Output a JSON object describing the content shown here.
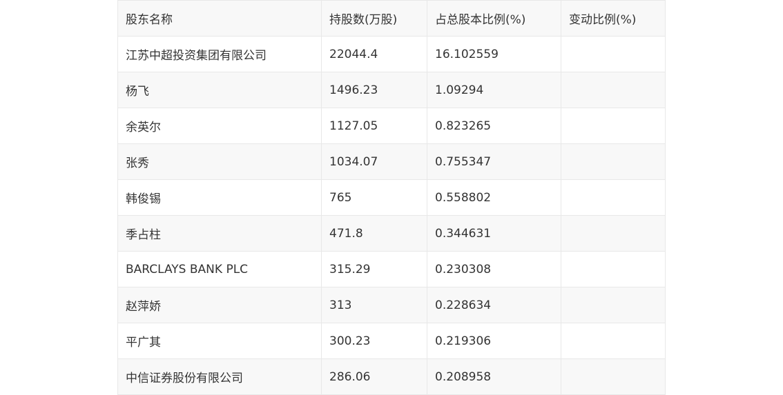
{
  "table": {
    "headers": [
      "股东名称",
      "持股数(万股)",
      "占总股本比例(%)",
      "变动比例(%)"
    ],
    "rows": [
      [
        "江苏中超投资集团有限公司",
        "22044.4",
        "16.102559",
        ""
      ],
      [
        "杨飞",
        "1496.23",
        "1.09294",
        ""
      ],
      [
        "余英尔",
        "1127.05",
        "0.823265",
        ""
      ],
      [
        "张秀",
        "1034.07",
        "0.755347",
        ""
      ],
      [
        "韩俊锡",
        "765",
        "0.558802",
        ""
      ],
      [
        "季占柱",
        "471.8",
        "0.344631",
        ""
      ],
      [
        "BARCLAYS BANK PLC",
        "315.29",
        "0.230308",
        ""
      ],
      [
        "赵萍娇",
        "313",
        "0.228634",
        ""
      ],
      [
        "平广其",
        "300.23",
        "0.219306",
        ""
      ],
      [
        "中信证券股份有限公司",
        "286.06",
        "0.208958",
        ""
      ]
    ]
  }
}
